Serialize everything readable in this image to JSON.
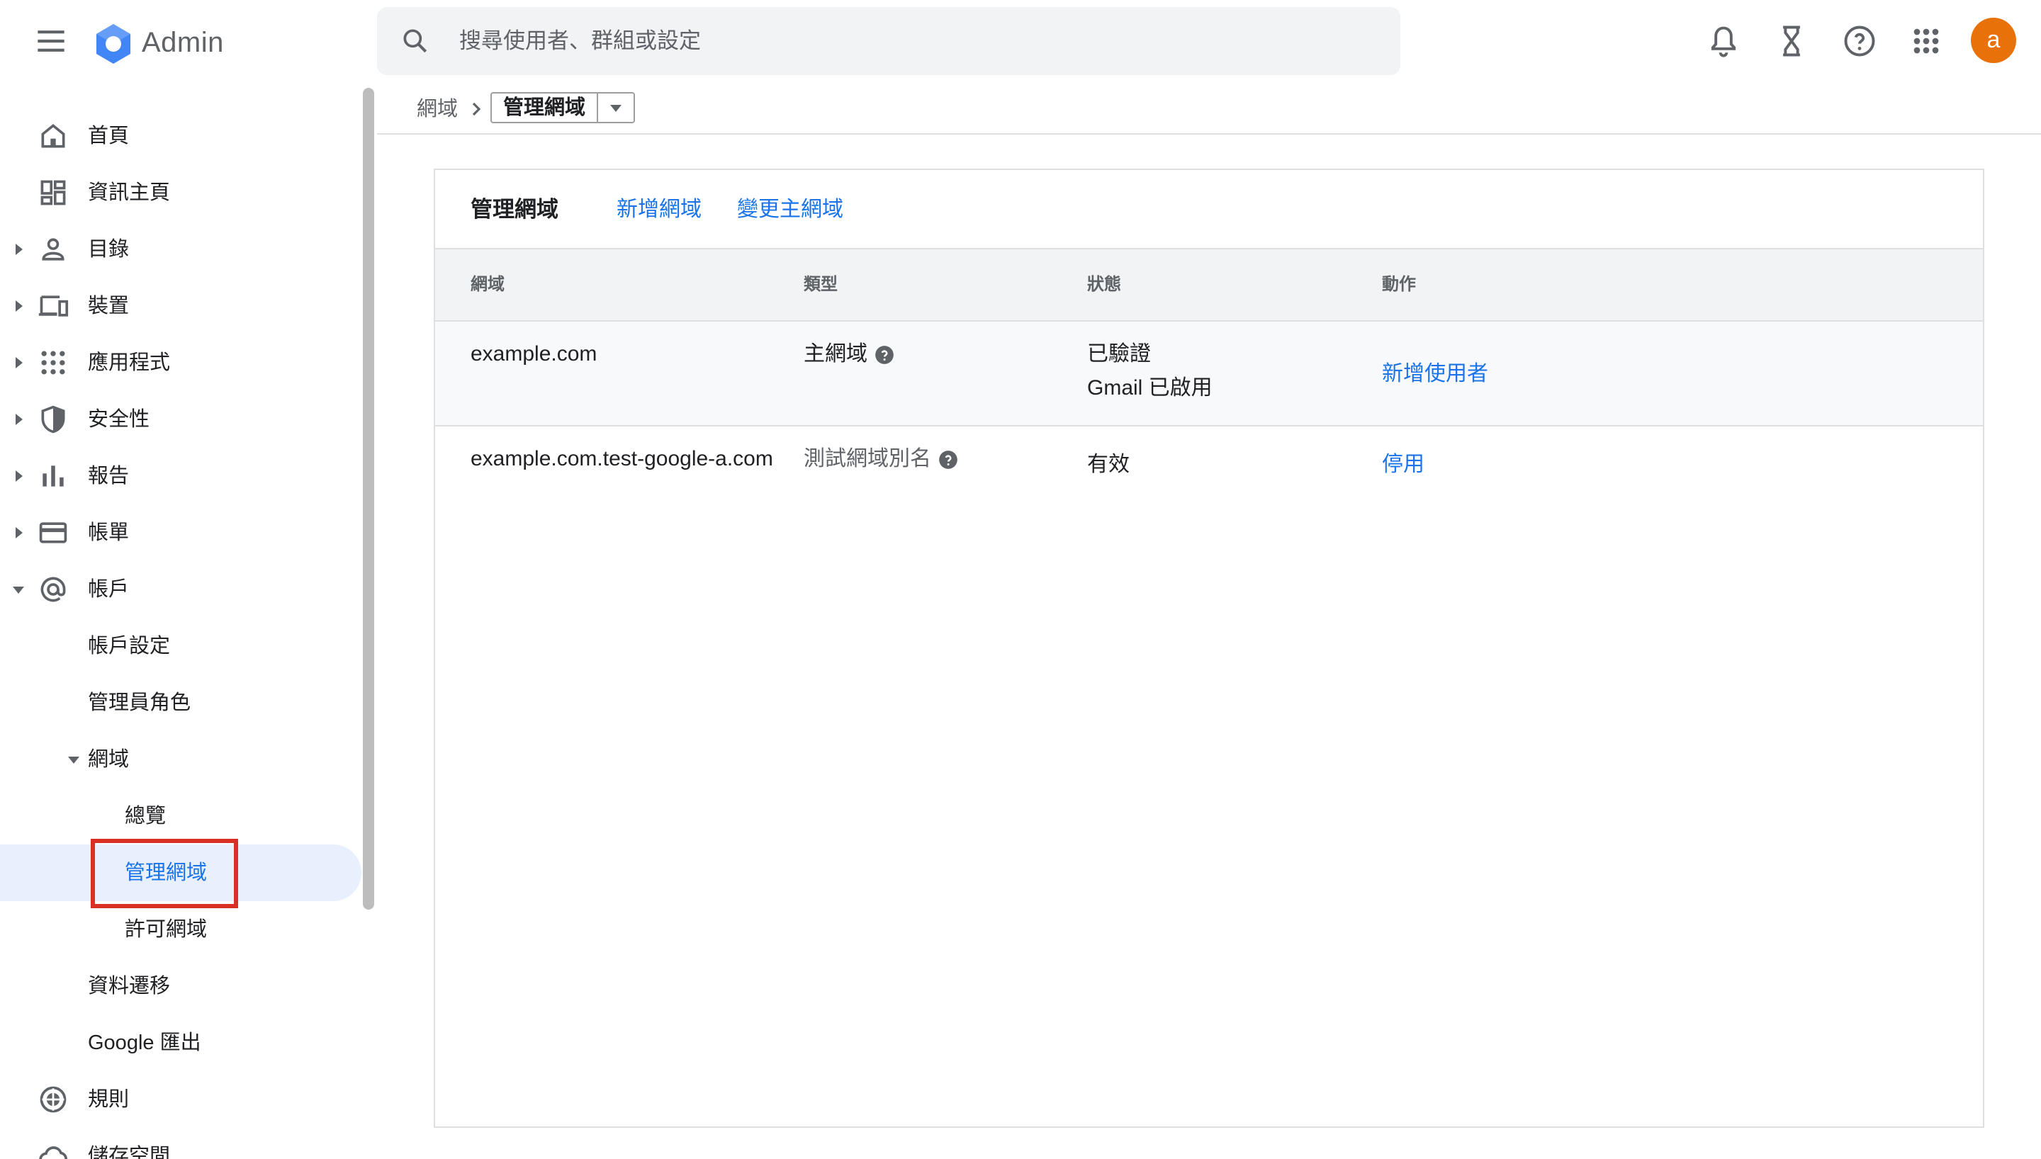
{
  "app": {
    "title": "Admin",
    "brand_color": "#1a73e8"
  },
  "search": {
    "placeholder": "搜尋使用者、群組或設定"
  },
  "toolbar": {
    "icons": [
      "bell-icon",
      "hourglass-icon",
      "help-icon",
      "apps-grid-icon"
    ],
    "avatar_letter": "a",
    "avatar_color": "#e8710a"
  },
  "sidebar": {
    "items": [
      {
        "label": "首頁",
        "icon": "home-icon"
      },
      {
        "label": "資訊主頁",
        "icon": "dashboard-icon"
      },
      {
        "label": "目錄",
        "icon": "person-icon"
      },
      {
        "label": "裝置",
        "icon": "devices-icon"
      },
      {
        "label": "應用程式",
        "icon": "apps-icon"
      },
      {
        "label": "安全性",
        "icon": "shield-icon"
      },
      {
        "label": "報告",
        "icon": "bar-chart-icon"
      },
      {
        "label": "帳單",
        "icon": "credit-card-icon"
      },
      {
        "label": "帳戶",
        "icon": "at-sign-icon"
      },
      {
        "label": "帳戶設定"
      },
      {
        "label": "管理員角色"
      },
      {
        "label": "網域"
      },
      {
        "label": "總覽"
      },
      {
        "label": "管理網域",
        "active": true
      },
      {
        "label": "許可網域"
      },
      {
        "label": "資料遷移"
      },
      {
        "label": "Google 匯出"
      },
      {
        "label": "規則",
        "icon": "rules-icon"
      },
      {
        "label": "儲存空間",
        "icon": "cloud-icon"
      }
    ]
  },
  "breadcrumb": {
    "root": "網域",
    "current": "管理網域"
  },
  "card": {
    "title": "管理網域",
    "actions": [
      "新增網域",
      "變更主網域"
    ],
    "columns": [
      "網域",
      "類型",
      "狀態",
      "動作"
    ],
    "rows": [
      {
        "domain": "example.com",
        "type": "主網域",
        "status": [
          "已驗證",
          "Gmail 已啟用"
        ],
        "action": "新增使用者"
      },
      {
        "domain": "example.com.test-google-a.com",
        "type": "測試網域別名",
        "status": [
          "有效"
        ],
        "action": "停用"
      }
    ]
  }
}
